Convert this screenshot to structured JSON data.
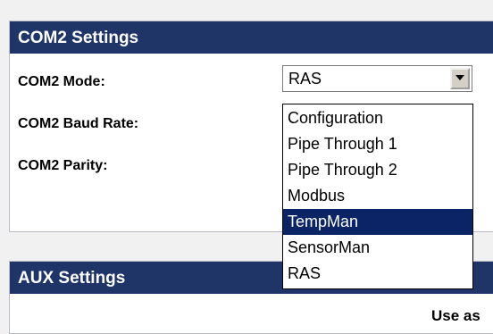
{
  "com2": {
    "title": "COM2 Settings",
    "mode_label": "COM2 Mode:",
    "baud_label": "COM2 Baud Rate:",
    "parity_label": "COM2 Parity:",
    "mode_value": "RAS",
    "mode_options": [
      "Configuration",
      "Pipe Through 1",
      "Pipe Through 2",
      "Modbus",
      "TempMan",
      "SensorMan",
      "RAS"
    ],
    "highlighted_option": "TempMan"
  },
  "aux": {
    "title": "AUX Settings",
    "partial_text": "Use as"
  },
  "colors": {
    "header_bg": "#1f3568",
    "highlight_bg": "#0b2466"
  },
  "icons": {
    "dropdown_arrow": "chevron-down-icon"
  }
}
